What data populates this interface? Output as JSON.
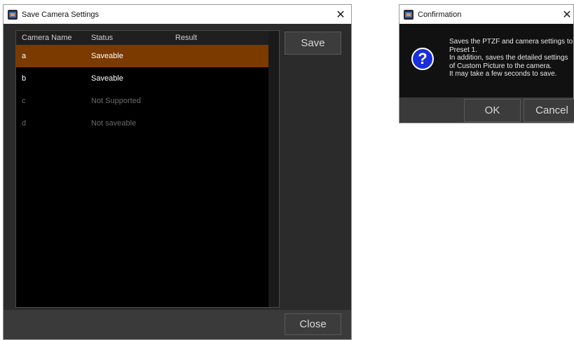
{
  "main_window": {
    "title": "Save Camera Settings",
    "close_glyph": "✕",
    "table": {
      "columns": [
        "Camera Name",
        "Status",
        "Result"
      ],
      "rows": [
        {
          "name": "a",
          "status": "Saveable",
          "result": "",
          "selected": true
        },
        {
          "name": "b",
          "status": "Saveable",
          "result": "",
          "selected": false
        },
        {
          "name": "c",
          "status": "Not Supported",
          "result": "",
          "selected": false
        },
        {
          "name": "d",
          "status": "Not saveable",
          "result": "",
          "selected": false
        }
      ]
    },
    "save_label": "Save",
    "close_label": "Close"
  },
  "confirm_dialog": {
    "title": "Confirmation",
    "close_glyph": "✕",
    "icon": "question-icon",
    "icon_glyph": "?",
    "message_lines": [
      "Saves the PTZF and camera settings to",
      "Preset 1.",
      "In addition, saves the detailed settings",
      "of Custom Picture to the camera.",
      "It may take a few seconds to save."
    ],
    "ok_label": "OK",
    "cancel_label": "Cancel"
  },
  "colors": {
    "selected_row": "#7a3a00",
    "window_bg": "#2b2b2b",
    "question_icon": "#1a2fd6"
  }
}
